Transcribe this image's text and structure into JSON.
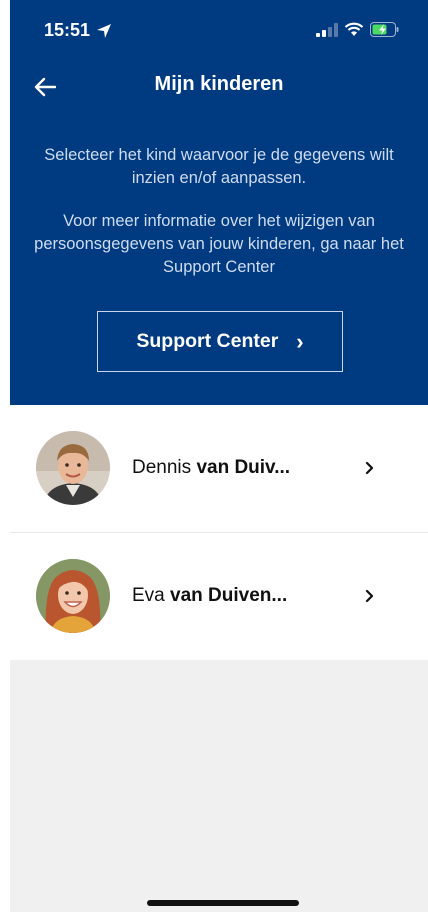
{
  "status_bar": {
    "time": "15:51"
  },
  "nav": {
    "title": "Mijn kinderen"
  },
  "intro": {
    "line1": "Selecteer het kind waarvoor je de gegevens wilt inzien en/of aanpassen.",
    "line2": "Voor meer informatie over het wijzigen van persoonsgegevens van jouw kinderen, ga naar het Support Center"
  },
  "support_button": {
    "label": "Support Center",
    "chevron": "›"
  },
  "children": [
    {
      "first_name": "Dennis",
      "last_name": "van Duiv...",
      "chevron": "›"
    },
    {
      "first_name": "Eva",
      "last_name": "van Duiven...",
      "chevron": "›"
    }
  ],
  "colors": {
    "header_bg": "#003a80",
    "page_bg": "#f0f0f0"
  }
}
